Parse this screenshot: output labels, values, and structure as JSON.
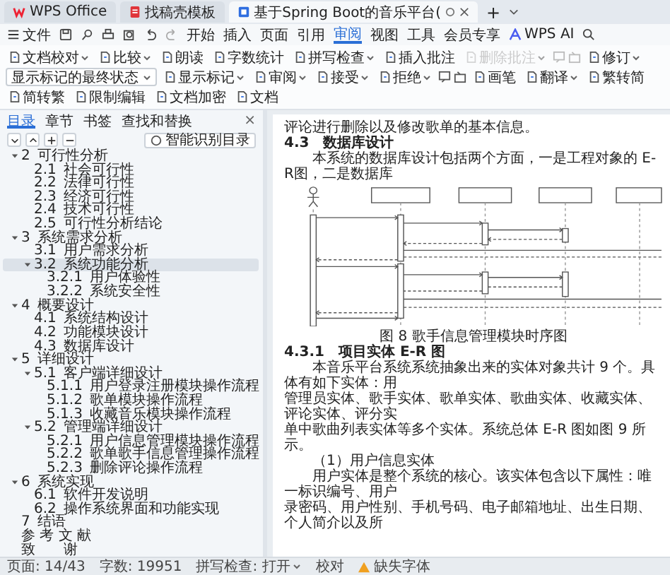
{
  "tabs": [
    {
      "label": "WPS Office",
      "kind": "home",
      "selected": false
    },
    {
      "label": "找稿壳模板",
      "kind": "pdf",
      "selected": false
    },
    {
      "label": "基于Spring Boot的音乐平台(",
      "kind": "doc",
      "selected": true
    }
  ],
  "new_tab": "+",
  "menu": {
    "file": "文件",
    "items": [
      {
        "label": "开始",
        "selected": false
      },
      {
        "label": "插入",
        "selected": false
      },
      {
        "label": "页面",
        "selected": false
      },
      {
        "label": "引用",
        "selected": false
      },
      {
        "label": "审阅",
        "selected": true
      },
      {
        "label": "视图",
        "selected": false
      },
      {
        "label": "工具",
        "selected": false
      },
      {
        "label": "会员专享",
        "selected": false
      }
    ],
    "ai": "WPS AI"
  },
  "ribbon": [
    {
      "kind": "button",
      "label": "文档校对",
      "dropdown": true,
      "disabled": false
    },
    {
      "kind": "button",
      "label": "比较",
      "dropdown": true,
      "disabled": false
    },
    {
      "kind": "button",
      "label": "朗读",
      "dropdown": false,
      "disabled": false
    },
    {
      "kind": "button",
      "label": "字数统计",
      "dropdown": false,
      "disabled": false
    },
    {
      "kind": "button",
      "label": "拼写检查",
      "dropdown": true,
      "disabled": false
    },
    {
      "kind": "button",
      "label": "插入批注",
      "dropdown": false,
      "disabled": false
    },
    {
      "kind": "button",
      "label": "删除批注",
      "dropdown": true,
      "disabled": true
    },
    {
      "kind": "nav",
      "disabled": true
    },
    {
      "kind": "button",
      "label": "修订",
      "dropdown": true,
      "disabled": false
    },
    {
      "kind": "select",
      "label": "显示标记的最终状态",
      "disabled": false
    },
    {
      "kind": "button",
      "label": "显示标记",
      "dropdown": true,
      "disabled": false
    },
    {
      "kind": "button",
      "label": "审阅",
      "dropdown": true,
      "disabled": false
    },
    {
      "kind": "button",
      "label": "接受",
      "dropdown": true,
      "disabled": false
    },
    {
      "kind": "button",
      "label": "拒绝",
      "dropdown": true,
      "disabled": false
    },
    {
      "kind": "nav",
      "disabled": false
    },
    {
      "kind": "button",
      "label": "画笔",
      "dropdown": false,
      "disabled": false
    },
    {
      "kind": "button",
      "label": "翻译",
      "dropdown": true,
      "disabled": false
    },
    {
      "kind": "button",
      "label": "繁转简",
      "dropdown": false,
      "disabled": false
    },
    {
      "kind": "button",
      "label": "简转繁",
      "dropdown": false,
      "disabled": false
    },
    {
      "kind": "button",
      "label": "限制编辑",
      "dropdown": false,
      "disabled": false
    },
    {
      "kind": "button",
      "label": "文档加密",
      "dropdown": false,
      "disabled": false
    },
    {
      "kind": "button",
      "label": "文档",
      "dropdown": false,
      "disabled": false
    }
  ],
  "sidebar": {
    "tabs": [
      {
        "label": "目录",
        "selected": true
      },
      {
        "label": "章节",
        "selected": false
      },
      {
        "label": "书签",
        "selected": false
      },
      {
        "label": "查找和替换",
        "selected": false
      }
    ],
    "close": "×",
    "smart_button": "智能识别目录",
    "toc": [
      {
        "number": "2",
        "title": "可行性分析",
        "expanded": true,
        "selected": false,
        "children": [
          {
            "number": "2.1",
            "title": "社会可行性",
            "selected": false
          },
          {
            "number": "2.2",
            "title": "法律可行性",
            "selected": false
          },
          {
            "number": "2.3",
            "title": "经济可行性",
            "selected": false
          },
          {
            "number": "2.4",
            "title": "技术可行性",
            "selected": false
          },
          {
            "number": "2.5",
            "title": "可行性分析结论",
            "selected": false
          }
        ]
      },
      {
        "number": "3",
        "title": "系统需求分析",
        "expanded": true,
        "selected": false,
        "children": [
          {
            "number": "3.1",
            "title": "用户需求分析",
            "selected": false
          },
          {
            "number": "3.2",
            "title": "系统功能分析",
            "expanded": true,
            "selected": true,
            "children": [
              {
                "number": "3.2.1",
                "title": "用户体验性",
                "selected": false
              },
              {
                "number": "3.2.2",
                "title": "系统安全性",
                "selected": false
              }
            ]
          }
        ]
      },
      {
        "number": "4",
        "title": "概要设计",
        "expanded": true,
        "selected": false,
        "children": [
          {
            "number": "4.1",
            "title": "系统结构设计",
            "selected": false
          },
          {
            "number": "4.2",
            "title": "功能模块设计",
            "selected": false
          },
          {
            "number": "4.3",
            "title": "数据库设计",
            "selected": false
          }
        ]
      },
      {
        "number": "5",
        "title": "详细设计",
        "expanded": true,
        "selected": false,
        "children": [
          {
            "number": "5.1",
            "title": "客户端详细设计",
            "expanded": true,
            "selected": false,
            "children": [
              {
                "number": "5.1.1",
                "title": "用户登录注册模块操作流程",
                "selected": false
              },
              {
                "number": "5.1.2",
                "title": "歌单模块操作流程",
                "selected": false
              },
              {
                "number": "5.1.3",
                "title": "收藏音乐模块操作流程",
                "selected": false
              }
            ]
          },
          {
            "number": "5.2",
            "title": "管理端详细设计",
            "expanded": true,
            "selected": false,
            "children": [
              {
                "number": "5.2.1",
                "title": "用户信息管理模块操作流程",
                "selected": false
              },
              {
                "number": "5.2.2",
                "title": "歌单歌手信息管理操作流程",
                "selected": false
              },
              {
                "number": "5.2.3",
                "title": "删除评论操作流程",
                "selected": false
              }
            ]
          }
        ]
      },
      {
        "number": "6",
        "title": "系统实现",
        "expanded": true,
        "selected": false,
        "children": [
          {
            "number": "6.1",
            "title": "软件开发说明",
            "selected": false
          },
          {
            "number": "6.2",
            "title": "操作系统界面和功能实现",
            "selected": false
          }
        ]
      },
      {
        "number": "7",
        "title": "结语",
        "selected": false
      },
      {
        "title": "参 考 文 献",
        "selected": false
      },
      {
        "title": "致　　谢",
        "selected": false
      }
    ]
  },
  "document": [
    {
      "kind": "text",
      "text": "评论进行删除以及修改歌单的基本信息。"
    },
    {
      "kind": "heading",
      "number": "4.3",
      "text": "数据库设计"
    },
    {
      "kind": "indent",
      "text": "本系统的数据库设计包括两个方面，一是工程对象的 E-R图，二是数据库"
    },
    {
      "kind": "diagram"
    },
    {
      "kind": "caption",
      "text": "图 8 歌手信息管理模块时序图"
    },
    {
      "kind": "heading",
      "number": "4.3.1",
      "text": "项目实体 E-R 图"
    },
    {
      "kind": "indent",
      "text": "本音乐平台系统系统抽象出来的实体对象共计 9 个。具体有如下实体：用"
    },
    {
      "kind": "text",
      "text": "管理员实体、歌手实体、歌单实体、歌曲实体、收藏实体、评论实体、评分实"
    },
    {
      "kind": "text",
      "text": "单中歌曲列表实体等多个实体。系统总体 E-R 图如图 9 所示。"
    },
    {
      "kind": "indent",
      "text": "（1）用户信息实体"
    },
    {
      "kind": "indent",
      "text": "用户实体是整个系统的核心。该实体包含以下属性：唯一标识编号、用户"
    },
    {
      "kind": "text",
      "text": "录密码、用户性别、手机号码、电子邮箱地址、出生日期、个人简介以及所"
    }
  ],
  "status_bar": [
    {
      "kind": "text",
      "label": "页面: 14/43"
    },
    {
      "kind": "text",
      "label": "字数: 19951"
    },
    {
      "kind": "dropdown",
      "label": "拼写检查: 打开"
    },
    {
      "kind": "text",
      "label": "校对"
    },
    {
      "kind": "warning",
      "label": "缺失字体"
    }
  ]
}
